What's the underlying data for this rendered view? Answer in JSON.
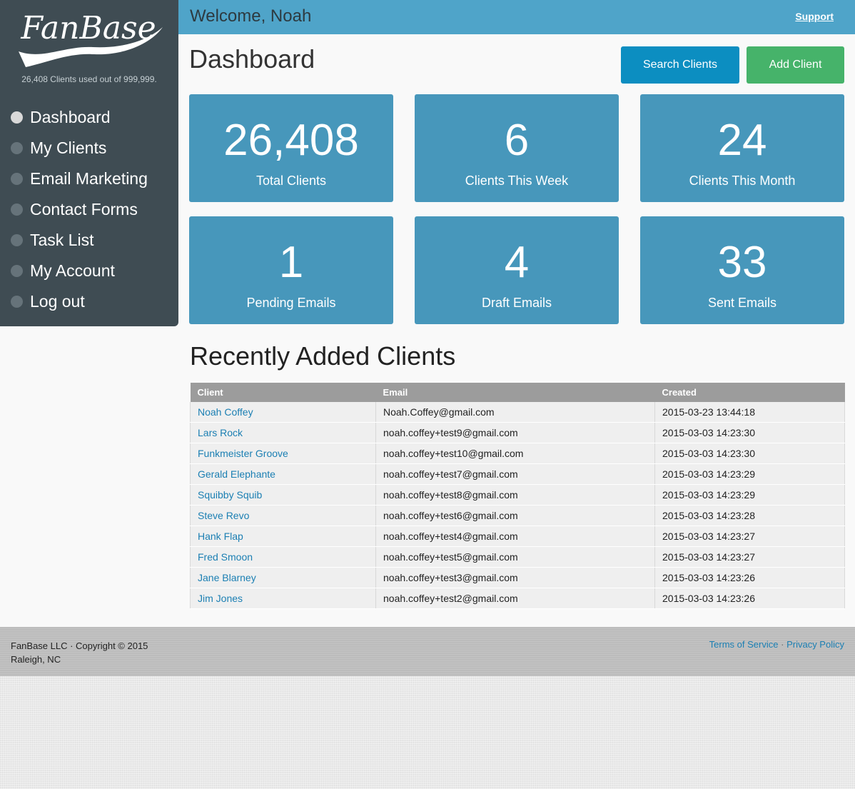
{
  "brand": {
    "logo_text": "FanBase",
    "usage": "26,408 Clients used out of 999,999."
  },
  "nav": [
    {
      "label": "Dashboard",
      "active": true
    },
    {
      "label": "My Clients"
    },
    {
      "label": "Email Marketing"
    },
    {
      "label": "Contact Forms"
    },
    {
      "label": "Task List"
    },
    {
      "label": "My Account"
    },
    {
      "label": "Log out"
    }
  ],
  "topbar": {
    "welcome": "Welcome, Noah",
    "support": "Support"
  },
  "header": {
    "title": "Dashboard",
    "search_button": "Search Clients",
    "add_button": "Add Client"
  },
  "stats": [
    {
      "value": "26,408",
      "label": "Total Clients"
    },
    {
      "value": "6",
      "label": "Clients This Week"
    },
    {
      "value": "24",
      "label": "Clients This Month"
    },
    {
      "value": "1",
      "label": "Pending Emails"
    },
    {
      "value": "4",
      "label": "Draft Emails"
    },
    {
      "value": "33",
      "label": "Sent Emails"
    }
  ],
  "recent": {
    "title": "Recently Added Clients",
    "columns": [
      "Client",
      "Email",
      "Created"
    ],
    "rows": [
      {
        "client": "Noah Coffey",
        "email": "Noah.Coffey@gmail.com",
        "created": "2015-03-23 13:44:18"
      },
      {
        "client": "Lars Rock",
        "email": "noah.coffey+test9@gmail.com",
        "created": "2015-03-03 14:23:30"
      },
      {
        "client": "Funkmeister Groove",
        "email": "noah.coffey+test10@gmail.com",
        "created": "2015-03-03 14:23:30"
      },
      {
        "client": "Gerald Elephante",
        "email": "noah.coffey+test7@gmail.com",
        "created": "2015-03-03 14:23:29"
      },
      {
        "client": "Squibby Squib",
        "email": "noah.coffey+test8@gmail.com",
        "created": "2015-03-03 14:23:29"
      },
      {
        "client": "Steve Revo",
        "email": "noah.coffey+test6@gmail.com",
        "created": "2015-03-03 14:23:28"
      },
      {
        "client": "Hank Flap",
        "email": "noah.coffey+test4@gmail.com",
        "created": "2015-03-03 14:23:27"
      },
      {
        "client": "Fred Smoon",
        "email": "noah.coffey+test5@gmail.com",
        "created": "2015-03-03 14:23:27"
      },
      {
        "client": "Jane Blarney",
        "email": "noah.coffey+test3@gmail.com",
        "created": "2015-03-03 14:23:26"
      },
      {
        "client": "Jim Jones",
        "email": "noah.coffey+test2@gmail.com",
        "created": "2015-03-03 14:23:26"
      }
    ]
  },
  "footer": {
    "copyright": "FanBase LLC · Copyright © 2015",
    "location": "Raleigh, NC",
    "terms": "Terms of Service",
    "separator": "·",
    "privacy": "Privacy Policy"
  }
}
